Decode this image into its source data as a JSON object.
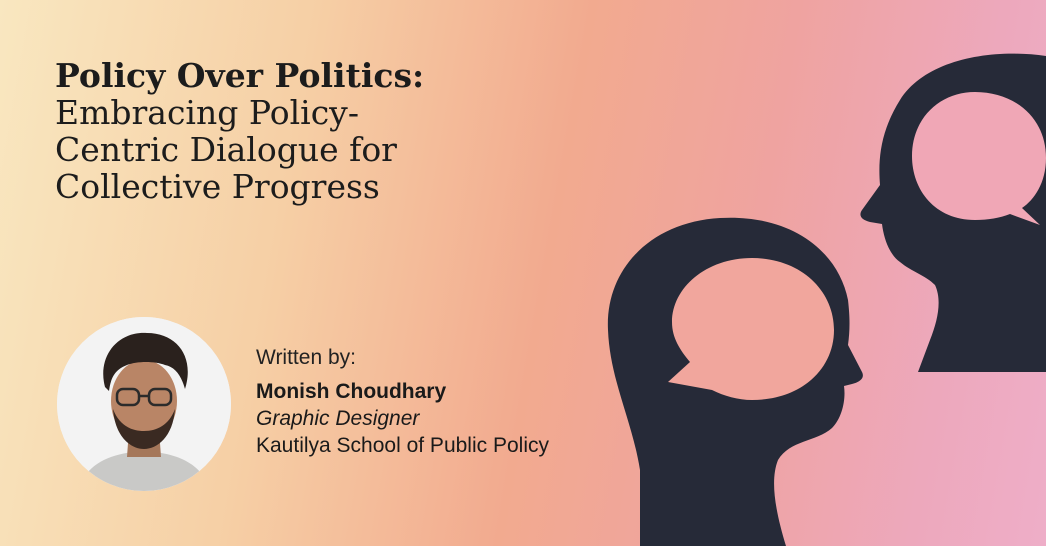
{
  "article": {
    "title_bold": "Policy Over Politics:",
    "title_rest": "Embracing Policy-Centric Dialogue for Collective Progress"
  },
  "author": {
    "written_by": "Written by:",
    "name": "Monish Choudhary",
    "role": "Graphic Designer",
    "organization": "Kautilya School of Public Policy"
  },
  "colors": {
    "gradient_left": "#f9e7c0",
    "gradient_mid": "#f2aa8f",
    "gradient_right": "#eeaec8",
    "silhouette": "#262a38"
  },
  "illustration": {
    "icons": [
      "head-silhouette-icon",
      "speech-bubble-icon"
    ]
  }
}
